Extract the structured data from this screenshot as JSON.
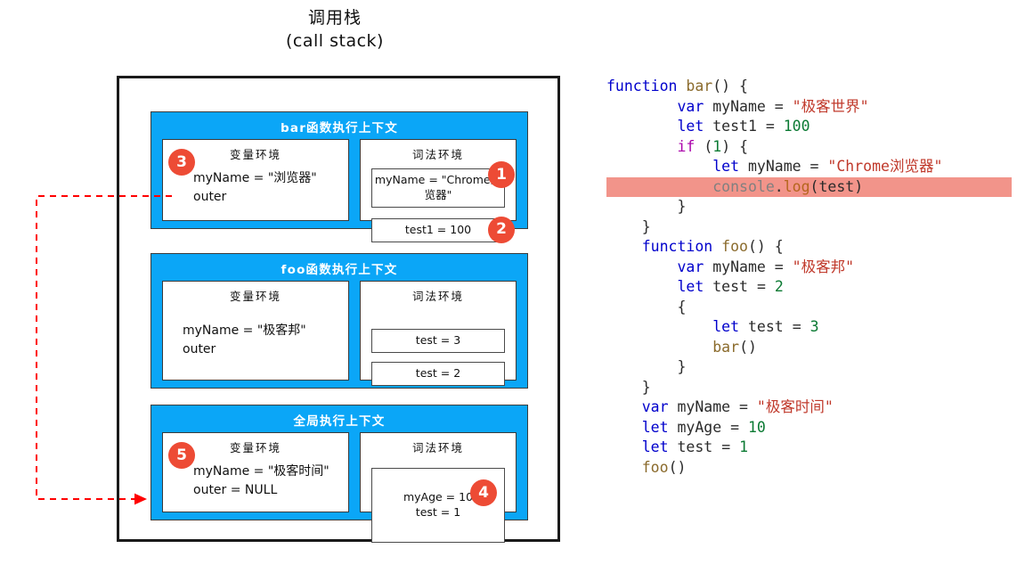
{
  "title": {
    "cn": "调用栈",
    "en": "(call stack)"
  },
  "colors": {
    "frame_blue": "#0BA6F7",
    "badge_red": "#ED4B35",
    "highlight": "#F2948A",
    "arrow_red": "#FF0000",
    "container_border": "#1A1A1A"
  },
  "stack": {
    "frames": [
      {
        "id": "bar",
        "title": "bar函数执行上下文",
        "variable_env": {
          "title": "变量环境",
          "lines": [
            "myName = \"浏览器\"",
            "outer"
          ],
          "badge": "3"
        },
        "lexical_env": {
          "title": "词法环境",
          "entries": [
            {
              "text": "myName = \"Chrome浏览器\"",
              "badge": "1"
            },
            {
              "text": "test1 = 100",
              "badge": "2"
            }
          ]
        }
      },
      {
        "id": "foo",
        "title": "foo函数执行上下文",
        "variable_env": {
          "title": "变量环境",
          "lines": [
            "myName = \"极客邦\"",
            "outer"
          ],
          "badge": ""
        },
        "lexical_env": {
          "title": "词法环境",
          "entries": [
            {
              "text": "test = 3",
              "badge": ""
            },
            {
              "text": "test = 2",
              "badge": ""
            }
          ]
        }
      },
      {
        "id": "global",
        "title": "全局执行上下文",
        "variable_env": {
          "title": "变量环境",
          "lines": [
            "myName = \"极客时间\"",
            "outer = NULL"
          ],
          "badge": "5"
        },
        "lexical_env": {
          "title": "词法环境",
          "entries": [
            {
              "text": "myAge = 10\ntest = 1",
              "badge": "4"
            }
          ]
        }
      }
    ]
  },
  "arrow": {
    "label": "outer-scope-chain-arrow",
    "from": "bar-variable-environment",
    "to": "global-variable-environment"
  },
  "code": {
    "highlighted_line_index": 6,
    "lines": [
      {
        "text": "function bar() {",
        "highlight": false
      },
      {
        "text": "        var myName = \"极客世界\"",
        "highlight": false
      },
      {
        "text": "        let test1 = 100",
        "highlight": false
      },
      {
        "text": "        if (1) {",
        "highlight": false
      },
      {
        "text": "            let myName = \"Chrome浏览器\"",
        "highlight": false
      },
      {
        "text": "            console.log(test)",
        "highlight": true
      },
      {
        "text": "        }",
        "highlight": false
      },
      {
        "text": "    }",
        "highlight": false
      },
      {
        "text": "    function foo() {",
        "highlight": false
      },
      {
        "text": "        var myName = \"极客邦\"",
        "highlight": false
      },
      {
        "text": "        let test = 2",
        "highlight": false
      },
      {
        "text": "        {",
        "highlight": false
      },
      {
        "text": "            let test = 3",
        "highlight": false
      },
      {
        "text": "            bar()",
        "highlight": false
      },
      {
        "text": "        }",
        "highlight": false
      },
      {
        "text": "    }",
        "highlight": false
      },
      {
        "text": "    var myName = \"极客时间\"",
        "highlight": false
      },
      {
        "text": "    let myAge = 10",
        "highlight": false
      },
      {
        "text": "    let test = 1",
        "highlight": false
      },
      {
        "text": "    foo()",
        "highlight": false
      }
    ]
  }
}
